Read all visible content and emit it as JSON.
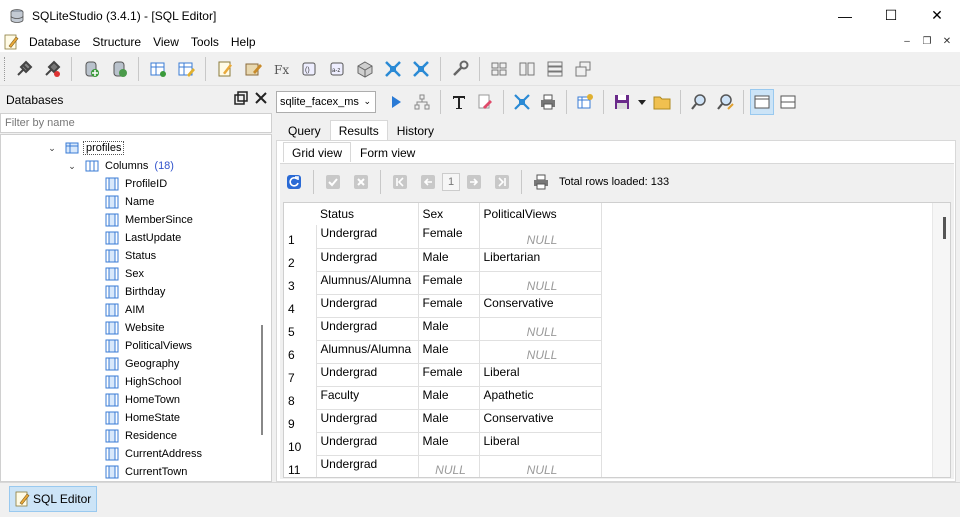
{
  "window": {
    "title": "SQLiteStudio (3.4.1) - [SQL Editor]",
    "minimize": "—",
    "maximize": "☐",
    "close": "✕"
  },
  "menubar": {
    "items": [
      "Database",
      "Structure",
      "View",
      "Tools",
      "Help"
    ],
    "mdi_min": "–",
    "mdi_restore": "❐",
    "mdi_close": "✕"
  },
  "databases_panel": {
    "title": "Databases",
    "filter_placeholder": "Filter by name",
    "table_name": "profiles",
    "columns_label": "Columns",
    "columns_count": "(18)",
    "columns": [
      "ProfileID",
      "Name",
      "MemberSince",
      "LastUpdate",
      "Status",
      "Sex",
      "Birthday",
      "AIM",
      "Website",
      "PoliticalViews",
      "Geography",
      "HighSchool",
      "HomeTown",
      "HomeState",
      "Residence",
      "CurrentAddress",
      "CurrentTown"
    ]
  },
  "editor": {
    "db_selected": "sqlite_facex_ms",
    "tabs": [
      "Query",
      "Results",
      "History"
    ],
    "active_tab": "Results",
    "subtabs": [
      "Grid view",
      "Form view"
    ],
    "active_subtab": "Grid view",
    "page": "1",
    "rows_loaded": "Total rows loaded: 133"
  },
  "grid": {
    "headers": [
      "Status",
      "Sex",
      "PoliticalViews"
    ],
    "null_text": "NULL",
    "rows": [
      {
        "n": "1",
        "status": "Undergrad",
        "sex": "Female",
        "pv": null
      },
      {
        "n": "2",
        "status": "Undergrad",
        "sex": "Male",
        "pv": "Libertarian"
      },
      {
        "n": "3",
        "status": "Alumnus/Alumna",
        "sex": "Female",
        "pv": null
      },
      {
        "n": "4",
        "status": "Undergrad",
        "sex": "Female",
        "pv": "Conservative"
      },
      {
        "n": "5",
        "status": "Undergrad",
        "sex": "Male",
        "pv": null
      },
      {
        "n": "6",
        "status": "Alumnus/Alumna",
        "sex": "Male",
        "pv": null
      },
      {
        "n": "7",
        "status": "Undergrad",
        "sex": "Female",
        "pv": "Liberal"
      },
      {
        "n": "8",
        "status": "Faculty",
        "sex": "Male",
        "pv": "Apathetic"
      },
      {
        "n": "9",
        "status": "Undergrad",
        "sex": "Male",
        "pv": "Conservative"
      },
      {
        "n": "10",
        "status": "Undergrad",
        "sex": "Male",
        "pv": "Liberal"
      },
      {
        "n": "11",
        "status": "Undergrad",
        "sex": null,
        "pv": null
      }
    ]
  },
  "taskbar": {
    "sql_editor_label": "SQL Editor"
  }
}
